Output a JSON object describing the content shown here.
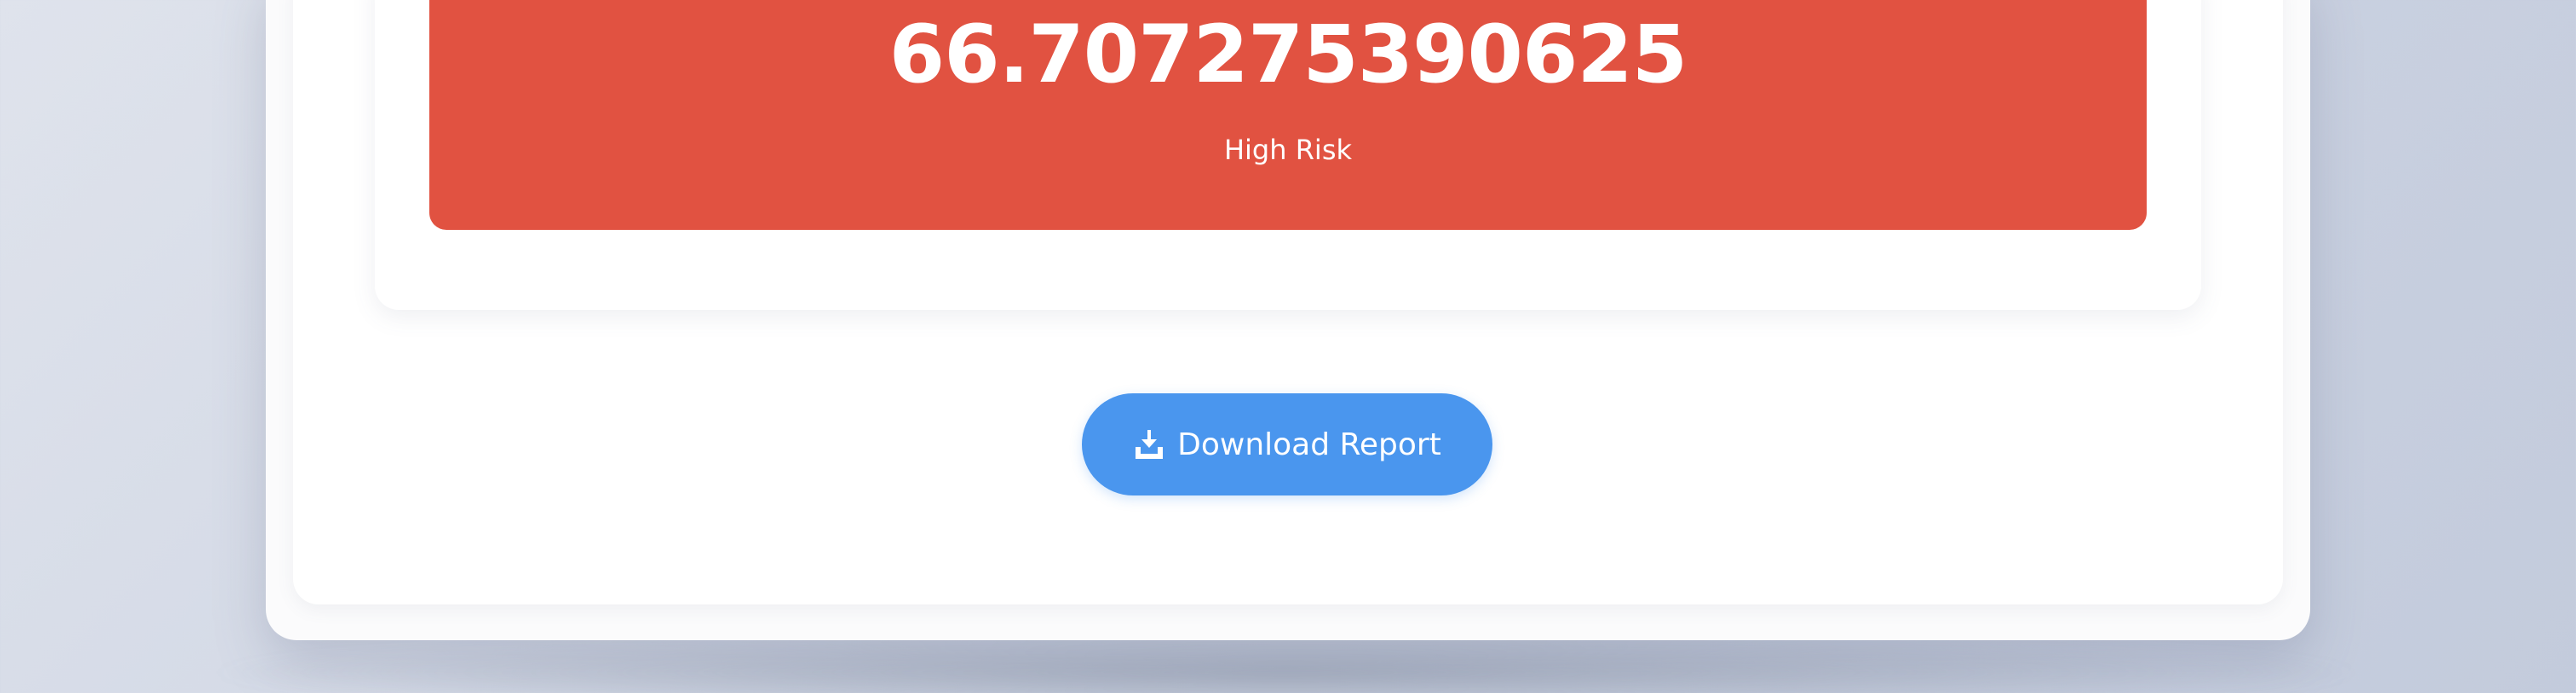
{
  "colors": {
    "risk_high": "#e15241",
    "button_primary": "#4a96ee"
  },
  "result": {
    "score": "66.707275390625",
    "risk_level": "High Risk"
  },
  "actions": {
    "download_label": "Download Report",
    "download_icon": "download-icon"
  }
}
